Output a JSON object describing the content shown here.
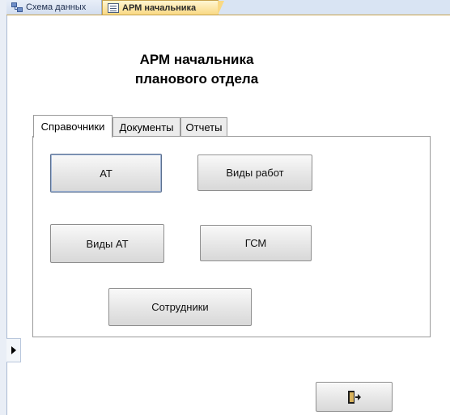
{
  "document_tabs": [
    {
      "label": "Схема данных",
      "icon": "relationships-icon"
    },
    {
      "label": "АРМ начальника",
      "icon": "form-icon"
    }
  ],
  "form": {
    "title": "АРМ начальника\nпланового отдела",
    "tabs": [
      {
        "label": "Справочники",
        "active": true
      },
      {
        "label": "Документы",
        "active": false
      },
      {
        "label": "Отчеты",
        "active": false
      }
    ],
    "buttons": {
      "at": "АТ",
      "work_types": "Виды работ",
      "at_types": "Виды АТ",
      "fuel": "ГСМ",
      "employees": "Сотрудники"
    },
    "exit_button_icon": "exit-door-icon"
  },
  "colors": {
    "active_doc_tab": "#f9d984",
    "tabstrip": "#d9e4f3"
  }
}
